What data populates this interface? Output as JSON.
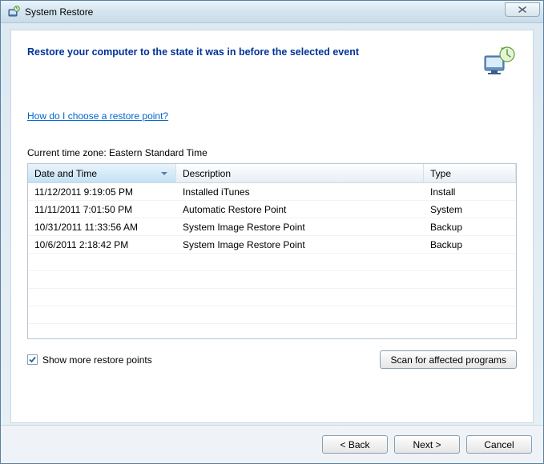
{
  "window": {
    "title": "System Restore"
  },
  "header": {
    "text": "Restore your computer to the state it was in before the selected event"
  },
  "help_link": "How do I choose a restore point?",
  "timezone_label": "Current time zone: Eastern Standard Time",
  "columns": {
    "date": "Date and Time",
    "desc": "Description",
    "type": "Type"
  },
  "rows": [
    {
      "date": "11/12/2011 9:19:05 PM",
      "desc": "Installed iTunes",
      "type": "Install"
    },
    {
      "date": "11/11/2011 7:01:50 PM",
      "desc": "Automatic Restore Point",
      "type": "System"
    },
    {
      "date": "10/31/2011 11:33:56 AM",
      "desc": "System Image Restore Point",
      "type": "Backup"
    },
    {
      "date": "10/6/2011 2:18:42 PM",
      "desc": "System Image Restore Point",
      "type": "Backup"
    }
  ],
  "show_more": {
    "label": "Show more restore points",
    "checked": true
  },
  "buttons": {
    "scan": "Scan for affected programs",
    "back": "< Back",
    "next": "Next >",
    "cancel": "Cancel"
  }
}
